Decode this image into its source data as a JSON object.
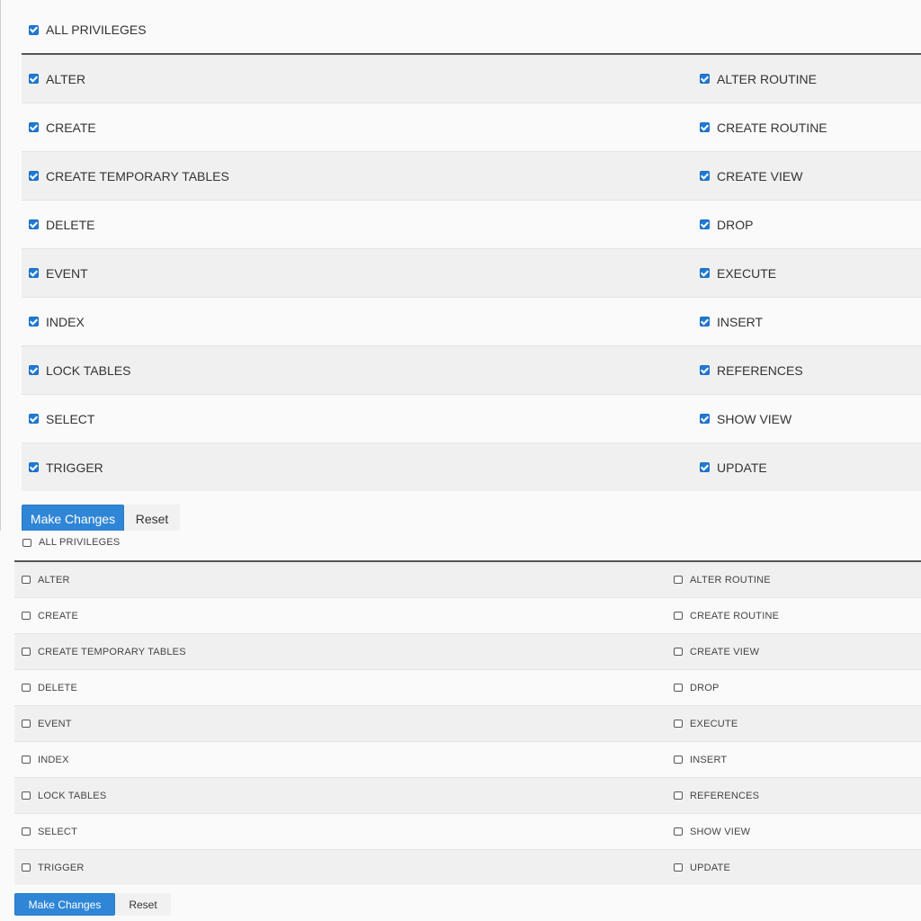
{
  "forms": [
    {
      "all_privileges": {
        "label": "ALL PRIVILEGES",
        "checked": true
      },
      "rows": [
        {
          "left": {
            "label": "ALTER",
            "checked": true
          },
          "right": {
            "label": "ALTER ROUTINE",
            "checked": true
          }
        },
        {
          "left": {
            "label": "CREATE",
            "checked": true
          },
          "right": {
            "label": "CREATE ROUTINE",
            "checked": true
          }
        },
        {
          "left": {
            "label": "CREATE TEMPORARY TABLES",
            "checked": true
          },
          "right": {
            "label": "CREATE VIEW",
            "checked": true
          }
        },
        {
          "left": {
            "label": "DELETE",
            "checked": true
          },
          "right": {
            "label": "DROP",
            "checked": true
          }
        },
        {
          "left": {
            "label": "EVENT",
            "checked": true
          },
          "right": {
            "label": "EXECUTE",
            "checked": true
          }
        },
        {
          "left": {
            "label": "INDEX",
            "checked": true
          },
          "right": {
            "label": "INSERT",
            "checked": true
          }
        },
        {
          "left": {
            "label": "LOCK TABLES",
            "checked": true
          },
          "right": {
            "label": "REFERENCES",
            "checked": true
          }
        },
        {
          "left": {
            "label": "SELECT",
            "checked": true
          },
          "right": {
            "label": "SHOW VIEW",
            "checked": true
          }
        },
        {
          "left": {
            "label": "TRIGGER",
            "checked": true
          },
          "right": {
            "label": "UPDATE",
            "checked": true
          }
        }
      ],
      "buttons": {
        "submit": "Make Changes",
        "reset": "Reset"
      }
    },
    {
      "all_privileges": {
        "label": "ALL PRIVILEGES",
        "checked": false
      },
      "rows": [
        {
          "left": {
            "label": "ALTER",
            "checked": false
          },
          "right": {
            "label": "ALTER ROUTINE",
            "checked": false
          }
        },
        {
          "left": {
            "label": "CREATE",
            "checked": false
          },
          "right": {
            "label": "CREATE ROUTINE",
            "checked": false
          }
        },
        {
          "left": {
            "label": "CREATE TEMPORARY TABLES",
            "checked": false
          },
          "right": {
            "label": "CREATE VIEW",
            "checked": false
          }
        },
        {
          "left": {
            "label": "DELETE",
            "checked": false
          },
          "right": {
            "label": "DROP",
            "checked": false
          }
        },
        {
          "left": {
            "label": "EVENT",
            "checked": false
          },
          "right": {
            "label": "EXECUTE",
            "checked": false
          }
        },
        {
          "left": {
            "label": "INDEX",
            "checked": false
          },
          "right": {
            "label": "INSERT",
            "checked": false
          }
        },
        {
          "left": {
            "label": "LOCK TABLES",
            "checked": false
          },
          "right": {
            "label": "REFERENCES",
            "checked": false
          }
        },
        {
          "left": {
            "label": "SELECT",
            "checked": false
          },
          "right": {
            "label": "SHOW VIEW",
            "checked": false
          }
        },
        {
          "left": {
            "label": "TRIGGER",
            "checked": false
          },
          "right": {
            "label": "UPDATE",
            "checked": false
          }
        }
      ],
      "buttons": {
        "submit": "Make Changes",
        "reset": "Reset"
      }
    }
  ],
  "colors": {
    "accent": "#1f7ad6",
    "button": "#2f86d6",
    "stripe": "#f0f0f0"
  },
  "icons": {
    "checked": "checkbox-checked-icon",
    "unchecked": "checkbox-unchecked-icon"
  }
}
